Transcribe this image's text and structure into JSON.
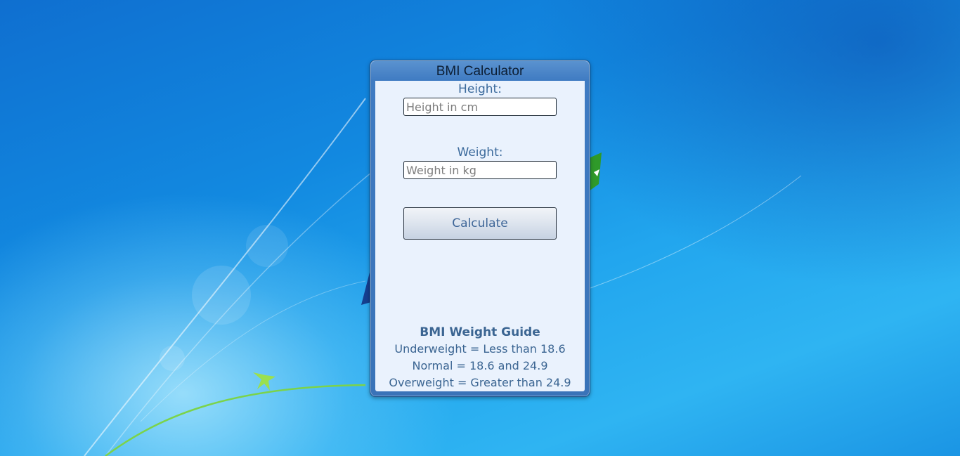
{
  "gadget": {
    "title": "BMI Calculator",
    "height": {
      "label": "Height:",
      "value": "",
      "placeholder": "Height in cm"
    },
    "weight": {
      "label": "Weight:",
      "value": "",
      "placeholder": "Weight in kg"
    },
    "calculate_label": "Calculate",
    "guide": {
      "title": "BMI Weight Guide",
      "lines": [
        "Underweight = Less than 18.6",
        "Normal = 18.6 and 24.9",
        "Overweight = Greater than 24.9"
      ]
    }
  },
  "colors": {
    "gadget_frame": "#3f7bc2",
    "gadget_body": "#eaf2fd",
    "label_text": "#3b6a9c",
    "desktop_blue": "#1289e0"
  }
}
